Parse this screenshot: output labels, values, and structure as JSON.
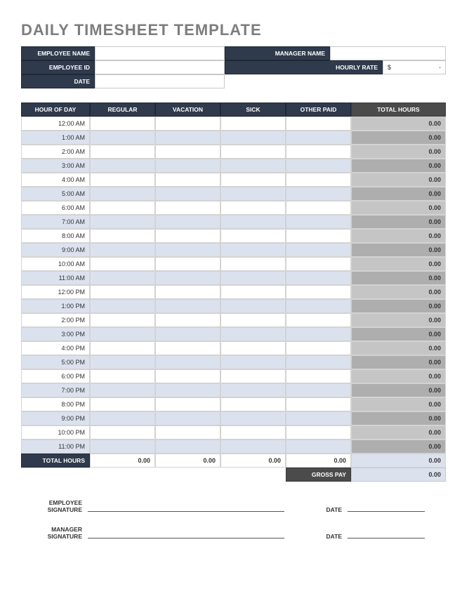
{
  "title": "DAILY TIMESHEET TEMPLATE",
  "header": {
    "employee_name_lbl": "EMPLOYEE NAME",
    "employee_name": "",
    "manager_name_lbl": "MANAGER NAME",
    "manager_name": "",
    "employee_id_lbl": "EMPLOYEE ID",
    "employee_id": "",
    "hourly_rate_lbl": "HOURLY RATE",
    "hourly_rate_currency": "$",
    "hourly_rate_value": "-",
    "date_lbl": "DATE",
    "date": ""
  },
  "columns": {
    "hour_of_day": "HOUR OF DAY",
    "regular": "REGULAR",
    "vacation": "VACATION",
    "sick": "SICK",
    "other_paid": "OTHER PAID",
    "total_hours": "TOTAL HOURS"
  },
  "rows": [
    {
      "hour": "12:00 AM",
      "regular": "",
      "vacation": "",
      "sick": "",
      "other": "",
      "total": "0.00"
    },
    {
      "hour": "1:00 AM",
      "regular": "",
      "vacation": "",
      "sick": "",
      "other": "",
      "total": "0.00"
    },
    {
      "hour": "2:00 AM",
      "regular": "",
      "vacation": "",
      "sick": "",
      "other": "",
      "total": "0.00"
    },
    {
      "hour": "3:00 AM",
      "regular": "",
      "vacation": "",
      "sick": "",
      "other": "",
      "total": "0.00"
    },
    {
      "hour": "4:00 AM",
      "regular": "",
      "vacation": "",
      "sick": "",
      "other": "",
      "total": "0.00"
    },
    {
      "hour": "5:00 AM",
      "regular": "",
      "vacation": "",
      "sick": "",
      "other": "",
      "total": "0.00"
    },
    {
      "hour": "6:00 AM",
      "regular": "",
      "vacation": "",
      "sick": "",
      "other": "",
      "total": "0.00"
    },
    {
      "hour": "7:00 AM",
      "regular": "",
      "vacation": "",
      "sick": "",
      "other": "",
      "total": "0.00"
    },
    {
      "hour": "8:00 AM",
      "regular": "",
      "vacation": "",
      "sick": "",
      "other": "",
      "total": "0.00"
    },
    {
      "hour": "9:00 AM",
      "regular": "",
      "vacation": "",
      "sick": "",
      "other": "",
      "total": "0.00"
    },
    {
      "hour": "10:00 AM",
      "regular": "",
      "vacation": "",
      "sick": "",
      "other": "",
      "total": "0.00"
    },
    {
      "hour": "11:00 AM",
      "regular": "",
      "vacation": "",
      "sick": "",
      "other": "",
      "total": "0.00"
    },
    {
      "hour": "12:00 PM",
      "regular": "",
      "vacation": "",
      "sick": "",
      "other": "",
      "total": "0.00"
    },
    {
      "hour": "1:00 PM",
      "regular": "",
      "vacation": "",
      "sick": "",
      "other": "",
      "total": "0.00"
    },
    {
      "hour": "2:00 PM",
      "regular": "",
      "vacation": "",
      "sick": "",
      "other": "",
      "total": "0.00"
    },
    {
      "hour": "3:00 PM",
      "regular": "",
      "vacation": "",
      "sick": "",
      "other": "",
      "total": "0.00"
    },
    {
      "hour": "4:00 PM",
      "regular": "",
      "vacation": "",
      "sick": "",
      "other": "",
      "total": "0.00"
    },
    {
      "hour": "5:00 PM",
      "regular": "",
      "vacation": "",
      "sick": "",
      "other": "",
      "total": "0.00"
    },
    {
      "hour": "6:00 PM",
      "regular": "",
      "vacation": "",
      "sick": "",
      "other": "",
      "total": "0.00"
    },
    {
      "hour": "7:00 PM",
      "regular": "",
      "vacation": "",
      "sick": "",
      "other": "",
      "total": "0.00"
    },
    {
      "hour": "8:00 PM",
      "regular": "",
      "vacation": "",
      "sick": "",
      "other": "",
      "total": "0.00"
    },
    {
      "hour": "9:00 PM",
      "regular": "",
      "vacation": "",
      "sick": "",
      "other": "",
      "total": "0.00"
    },
    {
      "hour": "10:00 PM",
      "regular": "",
      "vacation": "",
      "sick": "",
      "other": "",
      "total": "0.00"
    },
    {
      "hour": "11:00 PM",
      "regular": "",
      "vacation": "",
      "sick": "",
      "other": "",
      "total": "0.00"
    }
  ],
  "totals": {
    "label": "TOTAL HOURS",
    "regular": "0.00",
    "vacation": "0.00",
    "sick": "0.00",
    "other": "0.00",
    "total": "0.00"
  },
  "gross_pay": {
    "label": "GROSS PAY",
    "value": "0.00"
  },
  "signatures": {
    "employee_lbl": "EMPLOYEE SIGNATURE",
    "manager_lbl": "MANAGER SIGNATURE",
    "date_lbl": "DATE"
  }
}
